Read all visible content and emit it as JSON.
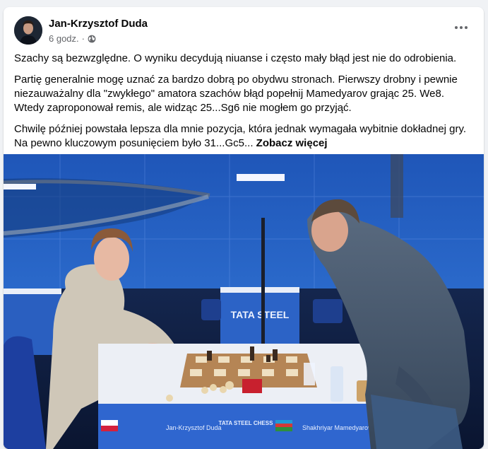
{
  "post": {
    "author": "Jan-Krzysztof Duda",
    "time": "6 godz.",
    "privacy_icon": "globe-icon",
    "paragraphs": [
      "Szachy są bezwzględne. O wyniku decydują niuanse i często mały błąd jest nie do odrobienia.",
      "Partię generalnie mogę uznać za bardzo dobrą po obydwu stronach. Pierwszy drobny i pewnie niezauważalny dla \"zwykłego\" amatora szachów błąd popełnij Mamedyarov grając 25. We8. Wtedy zaproponował remis, ale widząc 25...Sg6 nie mogłem go przyjąć.",
      "Chwilę później powstała lepsza dla mnie pozycja, która jednak wymagała wybitnie dokładnej gry. Na pewno kluczowym posunięciem było 31...Gc5..."
    ],
    "see_more": "Zobacz więcej"
  },
  "photo": {
    "event_logo": "TATA STEEL",
    "table_sign_left": "Jan-Krzysztof Duda",
    "table_sign_center": "TATA STEEL CHESS",
    "table_sign_right": "Shakhriyar Mamedyarov"
  }
}
